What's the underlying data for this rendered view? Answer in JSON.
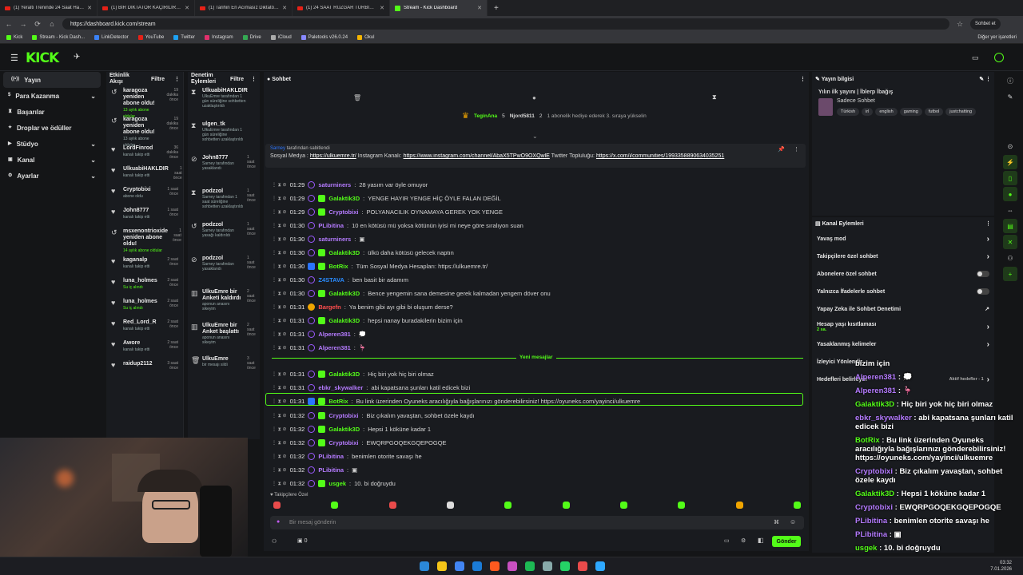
{
  "browser": {
    "tabs": [
      {
        "label": "(1) Yeralti Treninde 24 Saat Hayatt",
        "type": "yt"
      },
      {
        "label": "(1) BİR DİKTATÖR KAÇIRILIRSA NE",
        "type": "yt"
      },
      {
        "label": "(1) Tarihin En Acımasız Diktatör Ö",
        "type": "yt"
      },
      {
        "label": "(1) 24 SAAT RÜZGAR TÜRBİNİND",
        "type": "yt"
      },
      {
        "label": "Stream - Kick Dashboard",
        "type": "kick",
        "active": true
      }
    ],
    "url": "https://dashboard.kick.com/stream",
    "profile": "Sohbet et",
    "bookmarks": [
      "Kick",
      "Stream - Kick Dash...",
      "LinkDetector",
      "YouTube",
      "Twitter",
      "Instagram",
      "Drive",
      "iCloud",
      "Paletools v26.0.24",
      "Okul"
    ],
    "bookmark_colors": [
      "#53fc18",
      "#53fc18",
      "#3b82f6",
      "#e62117",
      "#1da1f2",
      "#e1306c",
      "#34a853",
      "#aaaaaa",
      "#8888ff",
      "#f5b400"
    ],
    "all_bookmarks": "Diğer yer işaretleri"
  },
  "kick": {
    "logo": "KICK",
    "logo_sup": "BETA"
  },
  "sidebar": {
    "items": [
      {
        "label": "Yayın",
        "icon": "broadcast-icon",
        "selected": true
      },
      {
        "label": "Para Kazanma",
        "icon": "dollar-icon",
        "chevron": true
      },
      {
        "label": "Başarılar",
        "icon": "trophy-icon"
      },
      {
        "label": "Droplar ve ödüller",
        "icon": "gift-icon"
      },
      {
        "label": "Stüdyo",
        "icon": "studio-icon",
        "chevron": true
      },
      {
        "label": "Kanal",
        "icon": "channel-icon",
        "chevron": true
      },
      {
        "label": "Ayarlar",
        "icon": "settings-icon",
        "chevron": true
      }
    ]
  },
  "activity": {
    "title": "Etkinlik Akışı",
    "filter": "Filtre",
    "items": [
      {
        "icon": "↺",
        "name": "karagoza yeniden abone oldu!",
        "sub": "13 aylık abone oldular",
        "green": true,
        "time": "19 dakika önce"
      },
      {
        "icon": "↺",
        "name": "karagoza yeniden abone oldu!",
        "sub": "13 aylık abone oldular",
        "green": false,
        "time": "19 dakika önce"
      },
      {
        "icon": "♥",
        "name": "LordFinrod",
        "sub": "kanalı takip etti",
        "green": false,
        "time": "36 dakika önce"
      },
      {
        "icon": "♥",
        "name": "UlkuabiHAKLDIR",
        "sub": "kanalı takip etti",
        "green": false,
        "time": "1 saat önce"
      },
      {
        "icon": "♥",
        "name": "Cryptobixi",
        "sub": "abone oldu",
        "green": false,
        "time": "1 saat önce"
      },
      {
        "icon": "♥",
        "name": "John8777",
        "sub": "kanalı takip etti",
        "green": false,
        "time": "1 saat önce"
      },
      {
        "icon": "↺",
        "name": "msxenontrioxide yeniden abone oldu!",
        "sub": "14 aylık abone oldular",
        "green": true,
        "time": "1 saat önce"
      },
      {
        "icon": "♥",
        "name": "kaganalp",
        "sub": "kanalı takip etti",
        "green": false,
        "time": "2 saat önce"
      },
      {
        "icon": "♥",
        "name": "luna_holmes",
        "sub": "Su iç alındı",
        "green": true,
        "time": "2 saat önce"
      },
      {
        "icon": "♥",
        "name": "luna_holmes",
        "sub": "Su iç alındı",
        "green": true,
        "time": "2 saat önce"
      },
      {
        "icon": "♥",
        "name": "Red_Lord_R",
        "sub": "kanalı takip etti",
        "green": false,
        "time": "2 saat önce"
      },
      {
        "icon": "♥",
        "name": "Awore",
        "sub": "kanalı takip etti",
        "green": false,
        "time": "2 saat önce"
      },
      {
        "icon": "♥",
        "name": "raidup2112",
        "sub": "",
        "green": false,
        "time": "3 saat önce"
      }
    ]
  },
  "moderation": {
    "title": "Denetim Eylemleri",
    "filter": "Filtre",
    "items": [
      {
        "icon": "⧗",
        "name": "UlkuabiHAKLDIR",
        "desc": "UlkuEmre tarafından 1 gün süreliğine sohbetten uzaklaştırıldı",
        "time": ""
      },
      {
        "icon": "⧗",
        "name": "ulgen_tk",
        "desc": "UlkuEmre tarafından 1 gün süreliğine sohbetten uzaklaştırıldı",
        "time": ""
      },
      {
        "icon": "⊘",
        "name": "John8777",
        "desc": "Sarney tarafından yasaklandı",
        "time": "1 saat önce"
      },
      {
        "icon": "⧗",
        "name": "podzzol",
        "desc": "Sarney tarafından 1 saat süreliğine sohbetten uzaklaştırıldı",
        "time": "1 saat önce"
      },
      {
        "icon": "↺",
        "name": "podzzol",
        "desc": "Sarney tarafından yasağı kaldırıldı",
        "time": "1 saat önce"
      },
      {
        "icon": "⊘",
        "name": "podzzol",
        "desc": "Sarney tarafından yasaklandı",
        "time": "1 saat önce"
      },
      {
        "icon": "▥",
        "name": "UlkuEmre bir Anketi kaldırdı",
        "desc": "aponun anasını sikeyim",
        "time": "2 saat önce"
      },
      {
        "icon": "▥",
        "name": "UlkuEmre bir Anket başlattı",
        "desc": "aponun anasını sikeyim",
        "time": "2 saat önce"
      },
      {
        "icon": "🗑",
        "name": "UlkuEmre",
        "desc": "bir mesajı sildi",
        "time": "3 saat önce"
      }
    ]
  },
  "chat": {
    "title": "Sohbet",
    "gift": {
      "user1": "TeginAna",
      "count1": "5",
      "user2": "Njord5811",
      "count2": "2",
      "text": "1 abonelik hediye ederek 3. sıraya yükselin"
    },
    "pinned": {
      "by": "Sarney",
      "by_text": "tarafından sabitlendi",
      "label": "Sosyal Medya :",
      "link1": "https://ulkuemre.tr/",
      "mid": "Instagram Kanalı:",
      "link2": "https://www.instagram.com/channel/AbaX5TPwO9OXQwlE",
      "mid2": "Twitter Topluluğu:",
      "link3": "https://x.com/i/communities/1993358890634035251"
    },
    "messages": [
      {
        "time": "01:29",
        "user": "saturniners",
        "color": "#b57bff",
        "badge": "",
        "text": "28 yasım var öyle omuyor"
      },
      {
        "time": "01:29",
        "user": "Galaktik3D",
        "color": "#53fc18",
        "badge": "sub",
        "text": "YENGE HAYIR YENGE HİÇ ÖYLE FALAN DEĞİL"
      },
      {
        "time": "01:29",
        "user": "Cryptobixi",
        "color": "#b57bff",
        "badge": "sub",
        "text": "POLYANACILIK OYNAMAYA GEREK YOK YENGE"
      },
      {
        "time": "01:30",
        "user": "PLibitina",
        "color": "#b57bff",
        "badge": "",
        "text": "10 en kötüsü mü yoksa kötünün iyisi mi neye göre sıralıyon suan"
      },
      {
        "time": "01:30",
        "user": "saturniners",
        "color": "#b57bff",
        "badge": "",
        "text": "▣"
      },
      {
        "time": "01:30",
        "user": "Galaktik3D",
        "color": "#53fc18",
        "badge": "sub",
        "text": "ülkü daha kötüsü gelecek naptın"
      },
      {
        "time": "01:30",
        "user": "BotRix",
        "color": "#53fc18",
        "badge": "bot",
        "text": "Tüm Sosyal Medya Hesapları: https://ulkuemre.tr/"
      },
      {
        "time": "01:30",
        "user": "Z4STAVA",
        "color": "#2a8cff",
        "badge": "",
        "text": "ben basit bir adamım"
      },
      {
        "time": "01:30",
        "user": "Galaktik3D",
        "color": "#53fc18",
        "badge": "sub",
        "text": "Bence yengemin sana demesine gerek kalmadan yengem döver onu"
      },
      {
        "time": "01:31",
        "user": "Bargefn",
        "color": "#ff4d4d",
        "badge": "gold",
        "text": "Ya benim gibi ayı gibi bi oluşum derse?"
      },
      {
        "time": "01:31",
        "user": "Galaktik3D",
        "color": "#53fc18",
        "badge": "sub",
        "text": "hepsi nanay buradakilerin bizim için"
      },
      {
        "time": "01:31",
        "user": "Alperen381",
        "color": "#b57bff",
        "badge": "",
        "text": "💭"
      },
      {
        "time": "01:31",
        "user": "Alperen381",
        "color": "#b57bff",
        "badge": "",
        "text": "🦩"
      },
      {
        "time": "01:31",
        "user": "Galaktik3D",
        "color": "#53fc18",
        "badge": "sub",
        "text": "Hiç biri yok hiç biri olmaz"
      },
      {
        "time": "01:31",
        "user": "ebkr_skywalker",
        "color": "#b57bff",
        "badge": "",
        "text": "abi kapatsana şunları katil edicek bizi"
      },
      {
        "time": "01:31",
        "user": "BotRix",
        "color": "#53fc18",
        "badge": "bot",
        "text": "Bu link üzerinden Oyuneks aracılığıyla bağışlarınızı gönderebilirsiniz! https://oyuneks.com/yayinci/ulkuemre"
      },
      {
        "time": "01:32",
        "user": "Cryptobixi",
        "color": "#b57bff",
        "badge": "sub",
        "text": "Biz çıkalım yavaştan, sohbet özele kaydı"
      },
      {
        "time": "01:32",
        "user": "Galaktik3D",
        "color": "#53fc18",
        "badge": "sub",
        "text": "Hepsi 1 köküne kadar 1"
      },
      {
        "time": "01:32",
        "user": "Cryptobixi",
        "color": "#b57bff",
        "badge": "sub",
        "text": "EWQRPGOQEKGQEPOGQE"
      },
      {
        "time": "01:32",
        "user": "PLibitina",
        "color": "#b57bff",
        "badge": "",
        "text": "benimlen otorite savaşı he"
      },
      {
        "time": "01:32",
        "user": "PLibitina",
        "color": "#b57bff",
        "badge": "",
        "text": "▣"
      },
      {
        "time": "01:32",
        "user": "usgek",
        "color": "#53fc18",
        "badge": "sub",
        "text": "10. bi doğruydu"
      }
    ],
    "new_messages": "Yeni mesajlar",
    "followers_only": "Takipçilere Özel",
    "input_placeholder": "Bir mesaj gönderin",
    "send": "Gönder",
    "points": "0"
  },
  "stream_info": {
    "title": "Yayın bilgisi",
    "stream_title": "Yılın ilk yayını | İblerp İbağış",
    "category": "Sadece Sohbet",
    "tags": [
      "Türkish",
      "irl",
      "english",
      "gaming",
      "futbol",
      "justchatting"
    ]
  },
  "channel_actions": {
    "title": "Kanal Eylemleri",
    "items": [
      {
        "label": "Yavaş mod",
        "type": "chev"
      },
      {
        "label": "Takipçilere özel sohbet",
        "type": "chev"
      },
      {
        "label": "Abonelere özel sohbet",
        "type": "toggle"
      },
      {
        "label": "Yalnızca İfadelerle sohbet",
        "type": "toggle"
      },
      {
        "label": "Yapay Zeka ile Sohbet Denetimi",
        "type": "ext"
      },
      {
        "label": "Hesap yaşı kısıtlaması",
        "sub": "2 sa.",
        "type": "chev"
      },
      {
        "label": "Yasaklanmış kelimeler",
        "type": "chev"
      },
      {
        "label": "İzleyici Yönlendir",
        "type": ""
      },
      {
        "label": "Hedefleri belirleyin",
        "sub2": "Aktif hedefler - 1",
        "type": "chev"
      }
    ]
  },
  "overlay": [
    {
      "user": "",
      "text": "bizim için"
    },
    {
      "user": "Alperen381",
      "text": "💭"
    },
    {
      "user": "Alperen381",
      "text": "🦩"
    },
    {
      "user": "Galaktik3D",
      "text": "Hiç biri yok hiç biri olmaz"
    },
    {
      "user": "ebkr_skywalker",
      "text": "abi kapatsana şunları katil edicek bizi"
    },
    {
      "user": "BotRix",
      "text": "Bu link üzerinden Oyuneks aracılığıyla bağışlarınızı gönderebilirsiniz! https://oyuneks.com/yayinci/ulkuemre"
    },
    {
      "user": "Cryptobixi",
      "text": "Biz çıkalım yavaştan, sohbet özele kaydı"
    },
    {
      "user": "Galaktik3D",
      "text": "Hepsi 1 köküne kadar 1"
    },
    {
      "user": "Cryptobixi",
      "text": "EWQRPGOQEKGQEPOGQE"
    },
    {
      "user": "PLibitina",
      "text": "benimlen otorite savaşı he"
    },
    {
      "user": "PLibitina",
      "text": "▣"
    },
    {
      "user": "usgek",
      "text": "10. bi doğruydu"
    }
  ],
  "taskbar": {
    "time": "03:32",
    "date": "7.01.2026"
  },
  "colors": {
    "accent": "#53fc18",
    "bg": "#141517",
    "panel": "#191b1f"
  }
}
